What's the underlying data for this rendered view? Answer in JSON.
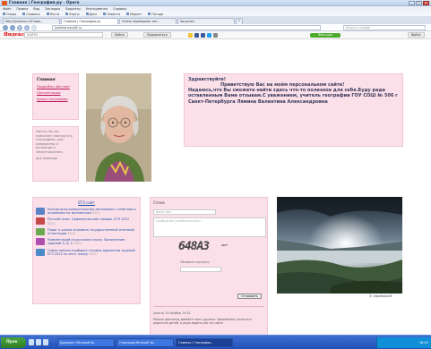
{
  "window": {
    "title": "Главная | География.ру - Opera",
    "controls": [
      "_",
      "□",
      "×"
    ]
  },
  "menubar": [
    "Файл",
    "Правка",
    "Вид",
    "Закладки",
    "Виджеты",
    "Инструменты",
    "Справка"
  ],
  "bookmarks": [
    "Опера",
    "Сервисы",
    "Почта",
    "Карты",
    "Диск",
    "Новости",
    "Маркет",
    "Погода"
  ],
  "tabs": [
    {
      "label": "http://lyamina.ru/Главн...",
      "active": false
    },
    {
      "label": "Главная | География.ру",
      "active": true
    },
    {
      "label": "Online переводчик тек...",
      "active": false
    },
    {
      "label": "Загрузка",
      "active": false
    },
    {
      "label": "+",
      "active": false
    }
  ],
  "nav": {
    "url": "lyamina.narod2.ru",
    "search_placeholder": "Искать в Google"
  },
  "yandex_bar": {
    "logo": "Яндекс",
    "search_placeholder": "НАЙТИ",
    "find_button": "Найти",
    "subscriptions": "Подписаться",
    "count_badge": "1",
    "green_button": "Фото дня",
    "right_label": "Войти"
  },
  "sidebar": {
    "heading": "Главная",
    "links": [
      "Подробно обо мне",
      "Презентации",
      "Уроки географии"
    ]
  },
  "quote": {
    "text": "Ничто так не помогает повтор ять географию, как извержени я вулканов и землетрясения",
    "author": "Дон Аминадо"
  },
  "welcome": {
    "greeting": "Здравствуйте!",
    "line1": "Приветствую Вас на моём персональном сайте!",
    "body": "Надеюсь,что Вы сможете найти здесь что-то полезное для себя.Буду рада оставленным Вами отзывам.С уважением, учитель географии ГОУ СОШ № 506 г Санкт-Петербурга Лямина Валентина Александровна"
  },
  "news": {
    "heading": "ЕГЭ сайт",
    "items": [
      {
        "title": "Контрольно-измерительные материалы с ответами к экзаменам по математике",
        "date": "2011"
      },
      {
        "title": "Русский язык. Орфоэпический словарь. ЕГЭ 2012",
        "date": "2011"
      },
      {
        "title": "Порог и шкала экзамена государственной итоговой аттестации",
        "date": "2011"
      },
      {
        "title": "Комментарий по русскому языку. Выполнение заданий А, В, С",
        "date": "2011"
      },
      {
        "title": "Самая полная подборка готовых вариантов заданий ЕГЭ 2012 по англ. языку",
        "date": "2011"
      }
    ]
  },
  "guestbook": {
    "heading": "Стена",
    "name_placeholder": "Ваше имя",
    "message_placeholder": "Сообщение (необязательно)",
    "captcha_text": "648АЗ",
    "captcha_label": "ЦВЕТ",
    "refresh_label": "Обновить картинку",
    "send_button": "Отправить",
    "last_author": "Ольга",
    "last_time": "(ольга) 14 Ноября 19:21",
    "last_message": "Милые девчонки,давайте жить дружно. Уважаемые учителя и родители детей, я рада видеть вас на сайте"
  },
  "landscape_credit": "© vlipnitsky45",
  "taskbar": {
    "start": "Пуск",
    "tasks": [
      "Документ Microsoft W...",
      "Страницы Microsoft W...",
      "Главная | География..."
    ],
    "clock": "18:05"
  },
  "colors": {
    "panel_pink": "#fbe0ea",
    "link_magenta": "#c01558",
    "heading_text": "#3a3a5a",
    "taskbar_blue": "#2250b8"
  }
}
